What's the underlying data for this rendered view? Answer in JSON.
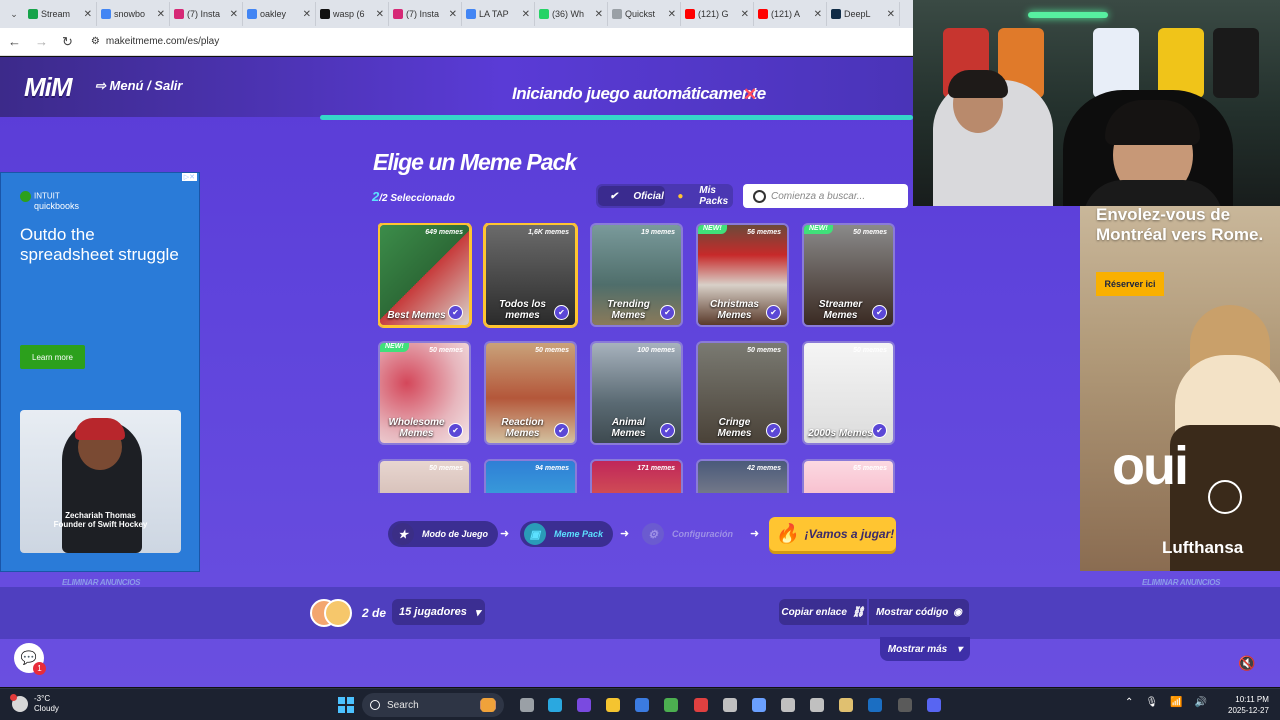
{
  "browser": {
    "tabs": [
      {
        "label": "Stream",
        "color": "#16a34a"
      },
      {
        "label": "snowbo",
        "color": "#4285f4"
      },
      {
        "label": "(7) Insta",
        "color": "#d62976"
      },
      {
        "label": "oakley",
        "color": "#4285f4"
      },
      {
        "label": "wasp (6",
        "color": "#111111"
      },
      {
        "label": "(7) Insta",
        "color": "#d62976"
      },
      {
        "label": "LA TAP",
        "color": "#4285f4"
      },
      {
        "label": "(36) Wh",
        "color": "#25d366"
      },
      {
        "label": "Quickst",
        "color": "#9aa0a6"
      },
      {
        "label": "(121) G",
        "color": "#ff0000"
      },
      {
        "label": "(121) A",
        "color": "#ff0000"
      },
      {
        "label": "DeepL",
        "color": "#0f2b46"
      }
    ],
    "url": "makeitmeme.com/es/play"
  },
  "game": {
    "logo": "MiM",
    "menu": "Menú / Salir",
    "autostart": "Iniciando juego automáticamente",
    "close": "✕",
    "autostart_progress": 1.0,
    "title": "Elige un Meme Pack",
    "selected_count": "2",
    "selected_suffix": "/2 Seleccionado",
    "toggle_official": "Oficial",
    "toggle_mine": "Mis Packs",
    "search_placeholder": "Comienza a buscar...",
    "new_badge": "NEW!",
    "packs": [
      {
        "name": "Best Memes",
        "count": "649 memes",
        "selected": true,
        "new": false
      },
      {
        "name": "Todos los memes",
        "count": "1,6K memes",
        "selected": true,
        "new": false
      },
      {
        "name": "Trending Memes",
        "count": "19 memes",
        "selected": false,
        "new": false
      },
      {
        "name": "Christmas Memes",
        "count": "56 memes",
        "selected": false,
        "new": true
      },
      {
        "name": "Streamer Memes",
        "count": "50 memes",
        "selected": false,
        "new": true
      },
      {
        "name": "Wholesome Memes",
        "count": "50 memes",
        "selected": false,
        "new": true
      },
      {
        "name": "Reaction Memes",
        "count": "50 memes",
        "selected": false,
        "new": false
      },
      {
        "name": "Animal Memes",
        "count": "100 memes",
        "selected": false,
        "new": false
      },
      {
        "name": "Cringe Memes",
        "count": "50 memes",
        "selected": false,
        "new": false
      },
      {
        "name": "2000s Memes",
        "count": "50 memes",
        "selected": false,
        "new": false
      },
      {
        "name": "",
        "count": "50 memes",
        "selected": false,
        "new": false
      },
      {
        "name": "",
        "count": "94 memes",
        "selected": false,
        "new": false
      },
      {
        "name": "",
        "count": "171 memes",
        "selected": false,
        "new": false
      },
      {
        "name": "",
        "count": "42 memes",
        "selected": false,
        "new": false
      },
      {
        "name": "",
        "count": "65 memes",
        "selected": false,
        "new": false
      }
    ],
    "steps": {
      "mode": "Modo de Juego",
      "pack": "Meme Pack",
      "config": "Configuración",
      "play": "¡Vamos a jugar!"
    },
    "remove_ads": "ELIMINAR ANUNCIOS",
    "players_prefix": "2 de",
    "players_select": "15 jugadores",
    "copy_link": "Copiar enlace",
    "show_code": "Mostrar código",
    "show_more": "Mostrar más",
    "chat_badge": "1"
  },
  "ad_left": {
    "brand_line1": "INTUIT",
    "brand_line2": "quickbooks",
    "headline": "Outdo the spreadsheet struggle",
    "cta": "Learn more",
    "caption_line1": "Zechariah Thomas",
    "caption_line2": "Founder of Swift Hockey"
  },
  "ad_right": {
    "headline": "Envolez-vous de Montréal vers Rome.",
    "cta": "Réserver ici",
    "slogan": "oui",
    "brand": "Lufthansa"
  },
  "taskbar": {
    "temp": "-3°C",
    "weather": "Cloudy",
    "search": "Search",
    "time": "10:11 PM",
    "date": "2025-12-27"
  }
}
